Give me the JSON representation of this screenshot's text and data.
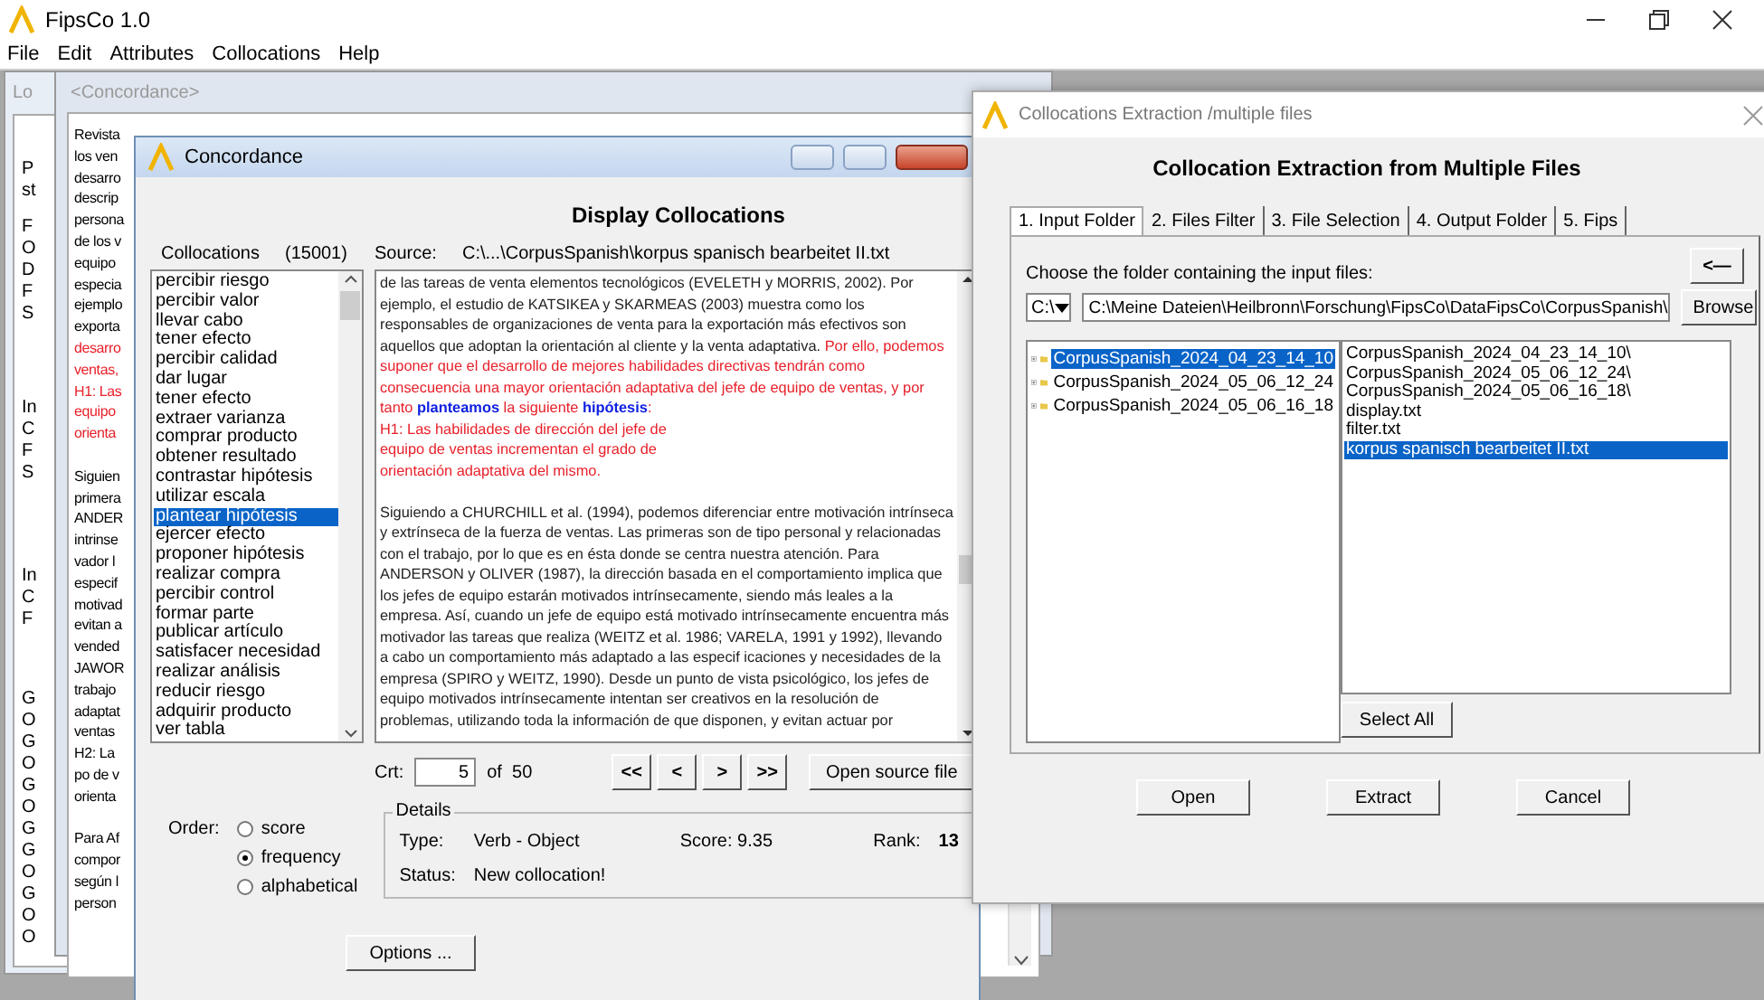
{
  "app_window": {
    "title": "FipsCo 1.0",
    "menu": [
      "File",
      "Edit",
      "Attributes",
      "Collocations",
      "Help"
    ]
  },
  "background_panel": {
    "title": "Lo",
    "text_groups": [
      [
        "P",
        "st"
      ],
      [
        "F",
        "O",
        "D",
        "F",
        "S"
      ],
      [
        "In",
        "C",
        "F",
        "S"
      ],
      [
        "In",
        "C",
        "F"
      ],
      [
        "G",
        "O",
        "G",
        "O",
        "G",
        "O",
        "G",
        "G",
        "O",
        "G",
        "O",
        "O"
      ]
    ]
  },
  "background_concordance": {
    "title": "<Concordance>",
    "paragraphs": [
      [
        {
          "text": "Revista",
          "highlighted": false
        },
        {
          "text": "los ven",
          "highlighted": false
        },
        {
          "text": "desarro",
          "highlighted": false
        },
        {
          "text": "descrip",
          "highlighted": false
        },
        {
          "text": "persona",
          "highlighted": false
        },
        {
          "text": "de los v",
          "highlighted": false
        },
        {
          "text": "equipo",
          "highlighted": false
        },
        {
          "text": "especia",
          "highlighted": false
        },
        {
          "text": "ejemplo",
          "highlighted": false
        },
        {
          "text": "exporta",
          "highlighted": false
        },
        {
          "text": "desarro",
          "highlighted": true
        },
        {
          "text": "ventas,",
          "highlighted": true
        },
        {
          "text": "H1: Las",
          "highlighted": true
        },
        {
          "text": "equipo",
          "highlighted": true
        },
        {
          "text": "orienta",
          "highlighted": true
        }
      ],
      [
        {
          "text": "Siguien",
          "highlighted": false
        },
        {
          "text": "primera",
          "highlighted": false
        },
        {
          "text": "ANDER",
          "highlighted": false
        },
        {
          "text": "intrinse",
          "highlighted": false
        },
        {
          "text": "vador l",
          "highlighted": false
        },
        {
          "text": "especif",
          "highlighted": false
        },
        {
          "text": "motivad",
          "highlighted": false
        },
        {
          "text": "evitan a",
          "highlighted": false
        },
        {
          "text": "vended",
          "highlighted": false
        },
        {
          "text": "JAWOR",
          "highlighted": false
        },
        {
          "text": "trabajo",
          "highlighted": false
        },
        {
          "text": "adaptat",
          "highlighted": false
        },
        {
          "text": "ventas",
          "highlighted": false
        },
        {
          "text": "H2: La",
          "highlighted": false
        },
        {
          "text": "po de v",
          "highlighted": false
        },
        {
          "text": "orienta",
          "highlighted": false
        }
      ],
      [
        {
          "text": "Para Af",
          "highlighted": false
        },
        {
          "text": "compor",
          "highlighted": false
        },
        {
          "text": "según l",
          "highlighted": false
        },
        {
          "text": "person",
          "highlighted": false
        }
      ]
    ]
  },
  "concordance_dialog": {
    "title": "Concordance",
    "heading": "Display Collocations",
    "collocations_label": "Collocations",
    "collocations_count": "(15001)",
    "source_label": "Source:",
    "source_path": "C:\\...\\CorpusSpanish\\korpus spanisch bearbeitet II.txt",
    "collocations": [
      {
        "text": "percibir riesgo",
        "selected": false
      },
      {
        "text": "percibir valor",
        "selected": false
      },
      {
        "text": "llevar cabo",
        "selected": false
      },
      {
        "text": "tener efecto",
        "selected": false
      },
      {
        "text": "percibir calidad",
        "selected": false
      },
      {
        "text": "dar lugar",
        "selected": false
      },
      {
        "text": "tener efecto",
        "selected": false
      },
      {
        "text": "extraer varianza",
        "selected": false
      },
      {
        "text": "comprar producto",
        "selected": false
      },
      {
        "text": "obtener resultado",
        "selected": false
      },
      {
        "text": "contrastar hipótesis",
        "selected": false
      },
      {
        "text": "utilizar escala",
        "selected": false
      },
      {
        "text": "plantear hipótesis",
        "selected": true
      },
      {
        "text": "ejercer efecto",
        "selected": false
      },
      {
        "text": "proponer hipótesis",
        "selected": false
      },
      {
        "text": "realizar compra",
        "selected": false
      },
      {
        "text": "percibir control",
        "selected": false
      },
      {
        "text": "formar parte",
        "selected": false
      },
      {
        "text": "publicar artículo",
        "selected": false
      },
      {
        "text": "satisfacer necesidad",
        "selected": false
      },
      {
        "text": "realizar análisis",
        "selected": false
      },
      {
        "text": "reducir riesgo",
        "selected": false
      },
      {
        "text": "adquirir producto",
        "selected": false
      },
      {
        "text": "ver tabla",
        "selected": false
      }
    ],
    "text_paragraphs": [
      [
        [
          {
            "text": "de las tareas de venta elementos tecnológicos (EVELETH y MORRIS, 2002). Por",
            "kind": "normal"
          }
        ],
        [
          {
            "text": "ejemplo, el estudio de KATSIKEA y SKARMEAS (2003) muestra como los",
            "kind": "normal"
          }
        ],
        [
          {
            "text": "responsables de organizaciones de venta para la exportación más efectivos son",
            "kind": "normal"
          }
        ],
        [
          {
            "text": "aquellos que adoptan la orientación al cliente y la venta adaptativa. ",
            "kind": "normal"
          },
          {
            "text": "Por ello, podemos",
            "kind": "highlight"
          }
        ],
        [
          {
            "text": "suponer que el desarrollo de mejores habilidades directivas tendrán como",
            "kind": "highlight"
          }
        ],
        [
          {
            "text": "consecuencia una mayor orientación adaptativa del jefe de equipo de ventas, y por",
            "kind": "highlight"
          }
        ],
        [
          {
            "text": "tanto ",
            "kind": "highlight"
          },
          {
            "text": "planteamos",
            "kind": "keyword"
          },
          {
            "text": " la siguiente ",
            "kind": "highlight"
          },
          {
            "text": "hipótesis",
            "kind": "keyword"
          },
          {
            "text": ":",
            "kind": "highlight"
          }
        ],
        [
          {
            "text": "H1: Las habilidades de dirección del jefe de",
            "kind": "highlight"
          }
        ],
        [
          {
            "text": "equipo de ventas incrementan el grado de",
            "kind": "highlight"
          }
        ],
        [
          {
            "text": "orientación adaptativa del mismo.",
            "kind": "highlight"
          }
        ]
      ],
      [
        [
          {
            "text": "Siguiendo a CHURCHILL et al. (1994), podemos diferenciar entre motivación intrínseca",
            "kind": "normal"
          }
        ],
        [
          {
            "text": "y extrínseca de la fuerza de ventas. Las primeras son de tipo personal y relacionadas",
            "kind": "normal"
          }
        ],
        [
          {
            "text": "con el trabajo, por lo que es en ésta donde se centra nuestra atención. Para",
            "kind": "normal"
          }
        ],
        [
          {
            "text": "ANDERSON y OLIVER (1987), la dirección basada en el comportamiento implica que",
            "kind": "normal"
          }
        ],
        [
          {
            "text": "los jefes de equipo estarán motivados intrínsecamente, siendo más leales a la",
            "kind": "normal"
          }
        ],
        [
          {
            "text": "empresa. Así, cuando un jefe de equipo está motivado intrínsecamente encuentra más",
            "kind": "normal"
          }
        ],
        [
          {
            "text": "motivador las tareas que realiza (WEITZ et al. 1986; VARELA, 1991 y 1992), llevando",
            "kind": "normal"
          }
        ],
        [
          {
            "text": "a cabo un comportamiento más adaptado a las especif icaciones y necesidades de la",
            "kind": "normal"
          }
        ],
        [
          {
            "text": "empresa (SPIRO y WEITZ, 1990). Desde un punto de vista psicológico, los jefes de",
            "kind": "normal"
          }
        ],
        [
          {
            "text": "equipo motivados intrínsecamente intentan ser creativos en la resolución de",
            "kind": "normal"
          }
        ],
        [
          {
            "text": "problemas, utilizando toda la información de que disponen, y evitan actuar por",
            "kind": "normal"
          }
        ]
      ]
    ],
    "crt_label": "Crt:",
    "crt_value": "5",
    "crt_total": "of  50",
    "nav_buttons": [
      "<<",
      "<",
      ">",
      ">>"
    ],
    "open_source_button": "Open source file",
    "order": {
      "label": "Order:",
      "options": [
        {
          "label": "score",
          "selected": false
        },
        {
          "label": "frequency",
          "selected": true
        },
        {
          "label": "alphabetical",
          "selected": false
        }
      ]
    },
    "details": {
      "title": "Details",
      "type_label": "Type:",
      "type_value": "Verb - Object",
      "score_label": "Score:",
      "score_value": "9.35",
      "rank_label": "Rank:",
      "rank_value": "13",
      "status_label": "Status:",
      "status_value": "New collocation!"
    },
    "options_button": "Options ..."
  },
  "extraction_dialog": {
    "title": "Collocations Extraction /multiple files",
    "heading": "Collocation Extraction from Multiple Files",
    "tabs": [
      {
        "label": "1. Input Folder",
        "selected": true
      },
      {
        "label": "2. Files Filter",
        "selected": false
      },
      {
        "label": "3. File Selection",
        "selected": false
      },
      {
        "label": "4. Output Folder",
        "selected": false
      },
      {
        "label": "5. Fips",
        "selected": false
      }
    ],
    "prompt": "Choose the folder containing the input files:",
    "back_button": "<—",
    "drive": "C:\\",
    "path": "C:\\Meine Dateien\\Heilbronn\\Forschung\\FipsCo\\DataFipsCo\\CorpusSpanish\\",
    "browse_button": "Browse",
    "folders": [
      {
        "label": "CorpusSpanish_2024_04_23_14_10",
        "selected": true
      },
      {
        "label": "CorpusSpanish_2024_05_06_12_24",
        "selected": false
      },
      {
        "label": "CorpusSpanish_2024_05_06_16_18",
        "selected": false
      }
    ],
    "files": [
      {
        "label": "CorpusSpanish_2024_04_23_14_10\\",
        "selected": false
      },
      {
        "label": "CorpusSpanish_2024_05_06_12_24\\",
        "selected": false
      },
      {
        "label": "CorpusSpanish_2024_05_06_16_18\\",
        "selected": false
      },
      {
        "label": "display.txt",
        "selected": false
      },
      {
        "label": "filter.txt",
        "selected": false
      },
      {
        "label": "korpus spanisch bearbeitet II.txt",
        "selected": true
      }
    ],
    "select_all_button": "Select All",
    "buttons": [
      "Open",
      "Extract",
      "Cancel"
    ]
  }
}
